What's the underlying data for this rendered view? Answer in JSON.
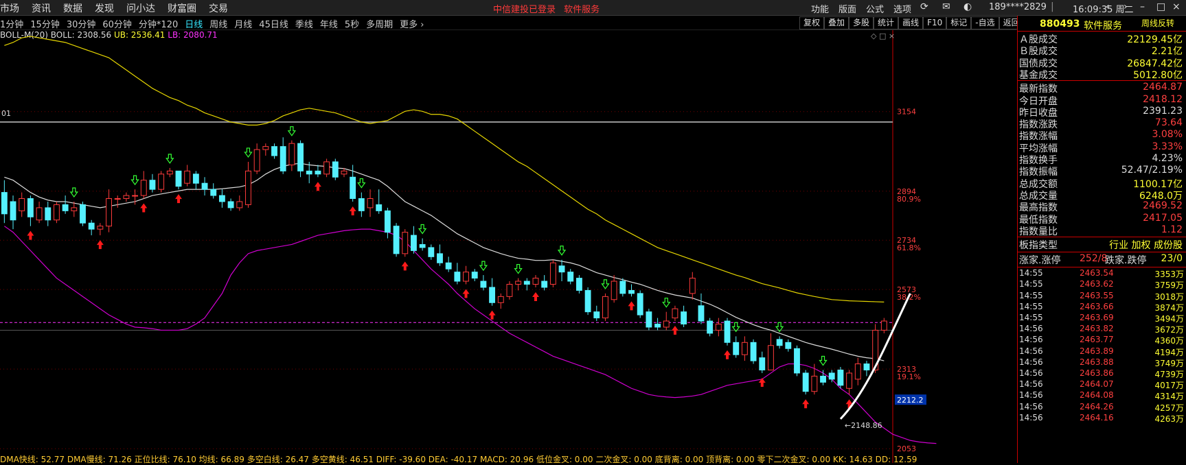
{
  "menubar": {
    "left_items": [
      "市场",
      "资讯",
      "数据",
      "发现",
      "问小达",
      "财富圈",
      "交易"
    ],
    "notice": [
      "中信建投已登录",
      "软件服务"
    ],
    "right_items": [
      "功能",
      "版面",
      "公式",
      "选项"
    ],
    "user": "189****2829",
    "time": "16:09:35 周二"
  },
  "periods": {
    "items": [
      "1分钟",
      "15分钟",
      "30分钟",
      "60分钟",
      "分钟*120",
      "日线",
      "周线",
      "月线",
      "45日线",
      "季线",
      "年线",
      "5秒",
      "多周期",
      "更多"
    ],
    "active_index": 5
  },
  "tools": [
    "复权",
    "叠加",
    "多股",
    "统计",
    "画线",
    "F10",
    "标记",
    "-自选",
    "返回"
  ],
  "boll": {
    "label": "BOLL-M(20)",
    "boll": "BOLL: 2308.56",
    "ub": "UB: 2536.41",
    "lb": "LB: 2080.71"
  },
  "price_axis": {
    "labels": [
      "3154",
      "2894",
      "2734",
      "2573",
      "2313",
      "2053"
    ],
    "fibs": [
      "80.9%",
      "61.8%",
      "38.2%",
      "19.1%"
    ],
    "current": "2212.2"
  },
  "annotations": {
    "low_marker": "2148.86",
    "left_label": "01"
  },
  "bottom_indicators": "DMA快线: 52.77  DMA慢线: 71.26  正位比线: 76.10  均线: 66.89  多空白线: 26.47  多空黄线: 46.51  DIFF: -39.60  DEA: -40.17  MACD: 20.96  低位金叉: 0.00  二次金叉: 0.00  底背离: 0.00  顶背离: 0.00  零下二次金叉: 0.00  KK: 14.63  DD: 12.59",
  "sidebar": {
    "code": "880493",
    "name": "软件服务",
    "tag": "周线反转",
    "summary": [
      {
        "k": "Ａ股成交",
        "v": "22129.45亿",
        "c": "#ffff33"
      },
      {
        "k": "Ｂ股成交",
        "v": "2.21亿",
        "c": "#ffff33"
      },
      {
        "k": "国债成交",
        "v": "26847.42亿",
        "c": "#ffff33"
      },
      {
        "k": "基金成交",
        "v": "5012.80亿",
        "c": "#ffff33"
      }
    ],
    "quote": [
      {
        "k": "最新指数",
        "v": "2464.87",
        "c": "#ff4040"
      },
      {
        "k": "今日开盘",
        "v": "2418.12",
        "c": "#ff4040"
      },
      {
        "k": "昨日收盘",
        "v": "2391.23",
        "c": "#dddddd"
      },
      {
        "k": "指数涨跌",
        "v": "73.64",
        "c": "#ff4040"
      },
      {
        "k": "指数涨幅",
        "v": "3.08%",
        "c": "#ff4040"
      },
      {
        "k": "平均涨幅",
        "v": "3.33%",
        "c": "#ff4040"
      },
      {
        "k": "指数换手",
        "v": "4.23%",
        "c": "#dddddd"
      },
      {
        "k": "指数振幅",
        "v": "52.47/2.19%",
        "c": "#dddddd"
      },
      {
        "k": "总成交额",
        "v": "1100.17亿",
        "c": "#ffff33"
      },
      {
        "k": "总成交量",
        "v": "6248.0万",
        "c": "#ffff33"
      },
      {
        "k": "最高指数",
        "v": "2469.52",
        "c": "#ff4040"
      },
      {
        "k": "最低指数",
        "v": "2417.05",
        "c": "#ff4040"
      },
      {
        "k": "指数量比",
        "v": "1.12",
        "c": "#ff4040"
      }
    ],
    "board": {
      "k": "板指类型",
      "v": "行业 加权 成份股",
      "c": "#ffff33"
    },
    "updown": {
      "k1": "涨家.涨停",
      "v1": "252/8",
      "k2": "跌家.跌停",
      "v2": "23/0"
    },
    "ticks": [
      {
        "t": "14:55",
        "p": "2463.54",
        "v": "3353万"
      },
      {
        "t": "14:55",
        "p": "2463.62",
        "v": "3759万"
      },
      {
        "t": "14:55",
        "p": "2463.55",
        "v": "3018万"
      },
      {
        "t": "14:55",
        "p": "2463.66",
        "v": "3874万"
      },
      {
        "t": "14:55",
        "p": "2463.69",
        "v": "3494万"
      },
      {
        "t": "14:56",
        "p": "2463.82",
        "v": "3672万"
      },
      {
        "t": "14:56",
        "p": "2463.77",
        "v": "4360万"
      },
      {
        "t": "14:56",
        "p": "2463.89",
        "v": "4194万"
      },
      {
        "t": "14:56",
        "p": "2463.88",
        "v": "3749万"
      },
      {
        "t": "14:56",
        "p": "2463.86",
        "v": "4739万"
      },
      {
        "t": "14:56",
        "p": "2464.07",
        "v": "4017万"
      },
      {
        "t": "14:56",
        "p": "2464.08",
        "v": "4314万"
      },
      {
        "t": "14:56",
        "p": "2464.26",
        "v": "4257万"
      },
      {
        "t": "14:56",
        "p": "2464.16",
        "v": "4263万"
      }
    ]
  },
  "chart_data": {
    "type": "candlestick",
    "ylim": [
      2040,
      3420
    ],
    "y_ticks": [
      3154,
      2894,
      2734,
      2573,
      2313,
      2053
    ],
    "candles": [
      [
        2890,
        2820,
        2930,
        2790
      ],
      [
        2860,
        2800,
        2880,
        2770
      ],
      [
        2830,
        2870,
        2890,
        2810
      ],
      [
        2870,
        2810,
        2880,
        2780
      ],
      [
        2800,
        2840,
        2860,
        2790
      ],
      [
        2840,
        2800,
        2860,
        2780
      ],
      [
        2800,
        2850,
        2860,
        2790
      ],
      [
        2850,
        2830,
        2880,
        2820
      ],
      [
        2830,
        2840,
        2860,
        2810
      ],
      [
        2850,
        2790,
        2860,
        2780
      ],
      [
        2790,
        2770,
        2800,
        2750
      ],
      [
        2770,
        2780,
        2790,
        2750
      ],
      [
        2780,
        2870,
        2900,
        2760
      ],
      [
        2870,
        2870,
        2880,
        2840
      ],
      [
        2870,
        2880,
        2890,
        2860
      ],
      [
        2880,
        2880,
        2900,
        2850
      ],
      [
        2880,
        2930,
        2960,
        2870
      ],
      [
        2930,
        2900,
        2950,
        2890
      ],
      [
        2900,
        2950,
        2960,
        2890
      ],
      [
        2950,
        2960,
        2970,
        2940
      ],
      [
        2960,
        2910,
        2960,
        2900
      ],
      [
        2920,
        2960,
        2980,
        2910
      ],
      [
        2950,
        2920,
        2960,
        2900
      ],
      [
        2920,
        2900,
        2940,
        2880
      ],
      [
        2900,
        2880,
        2920,
        2870
      ],
      [
        2880,
        2860,
        2900,
        2840
      ],
      [
        2860,
        2840,
        2870,
        2830
      ],
      [
        2840,
        2860,
        2880,
        2830
      ],
      [
        2850,
        2960,
        2990,
        2840
      ],
      [
        2960,
        3030,
        3050,
        2950
      ],
      [
        3030,
        3040,
        3050,
        3010
      ],
      [
        3040,
        3010,
        3050,
        3000
      ],
      [
        3040,
        2960,
        3070,
        2950
      ],
      [
        2980,
        3050,
        3060,
        2960
      ],
      [
        3050,
        2960,
        3060,
        2940
      ],
      [
        2960,
        2950,
        2990,
        2920
      ],
      [
        2960,
        2950,
        2980,
        2940
      ],
      [
        2950,
        2990,
        3000,
        2940
      ],
      [
        2990,
        2940,
        3000,
        2930
      ],
      [
        2950,
        2960,
        2970,
        2940
      ],
      [
        2940,
        2870,
        2980,
        2860
      ],
      [
        2870,
        2830,
        2890,
        2810
      ],
      [
        2840,
        2870,
        2900,
        2810
      ],
      [
        2850,
        2830,
        2900,
        2820
      ],
      [
        2830,
        2760,
        2840,
        2740
      ],
      [
        2780,
        2690,
        2790,
        2680
      ],
      [
        2690,
        2760,
        2770,
        2680
      ],
      [
        2750,
        2700,
        2780,
        2690
      ],
      [
        2720,
        2710,
        2740,
        2700
      ],
      [
        2710,
        2680,
        2720,
        2670
      ],
      [
        2690,
        2660,
        2720,
        2650
      ],
      [
        2660,
        2640,
        2680,
        2630
      ],
      [
        2630,
        2600,
        2660,
        2590
      ],
      [
        2600,
        2630,
        2650,
        2590
      ],
      [
        2630,
        2610,
        2640,
        2600
      ],
      [
        2600,
        2580,
        2620,
        2570
      ],
      [
        2580,
        2530,
        2610,
        2520
      ],
      [
        2530,
        2550,
        2560,
        2510
      ],
      [
        2550,
        2590,
        2600,
        2540
      ],
      [
        2590,
        2600,
        2610,
        2570
      ],
      [
        2600,
        2590,
        2610,
        2570
      ],
      [
        2590,
        2610,
        2620,
        2580
      ],
      [
        2600,
        2580,
        2620,
        2570
      ],
      [
        2590,
        2660,
        2670,
        2580
      ],
      [
        2650,
        2630,
        2670,
        2600
      ],
      [
        2630,
        2600,
        2640,
        2590
      ],
      [
        2610,
        2570,
        2620,
        2560
      ],
      [
        2570,
        2500,
        2580,
        2490
      ],
      [
        2500,
        2480,
        2520,
        2470
      ],
      [
        2480,
        2550,
        2560,
        2470
      ],
      [
        2540,
        2600,
        2620,
        2530
      ],
      [
        2600,
        2560,
        2610,
        2550
      ],
      [
        2570,
        2560,
        2590,
        2550
      ],
      [
        2560,
        2490,
        2570,
        2480
      ],
      [
        2500,
        2450,
        2510,
        2440
      ],
      [
        2460,
        2450,
        2480,
        2440
      ],
      [
        2450,
        2470,
        2500,
        2440
      ],
      [
        2480,
        2510,
        2520,
        2470
      ],
      [
        2500,
        2460,
        2520,
        2450
      ],
      [
        2560,
        2610,
        2630,
        2540
      ],
      [
        2520,
        2470,
        2560,
        2460
      ],
      [
        2470,
        2430,
        2480,
        2420
      ],
      [
        2440,
        2460,
        2480,
        2420
      ],
      [
        2470,
        2400,
        2480,
        2390
      ],
      [
        2400,
        2360,
        2420,
        2350
      ],
      [
        2360,
        2400,
        2420,
        2340
      ],
      [
        2400,
        2340,
        2410,
        2330
      ],
      [
        2350,
        2310,
        2370,
        2300
      ],
      [
        2310,
        2390,
        2430,
        2310
      ],
      [
        2410,
        2390,
        2420,
        2380
      ],
      [
        2400,
        2380,
        2410,
        2370
      ],
      [
        2380,
        2300,
        2390,
        2290
      ],
      [
        2300,
        2240,
        2310,
        2230
      ],
      [
        2240,
        2290,
        2330,
        2230
      ],
      [
        2290,
        2270,
        2310,
        2260
      ],
      [
        2300,
        2280,
        2310,
        2270
      ],
      [
        2310,
        2260,
        2320,
        2250
      ],
      [
        2250,
        2300,
        2310,
        2230
      ],
      [
        2280,
        2330,
        2350,
        2260
      ],
      [
        2330,
        2310,
        2340,
        2290
      ],
      [
        2310,
        2440,
        2460,
        2300
      ],
      [
        2440,
        2470,
        2480,
        2430
      ]
    ],
    "mid_line": [
      2940,
      2930,
      2910,
      2890,
      2875,
      2865,
      2860,
      2860,
      2855,
      2850,
      2845,
      2840,
      2845,
      2850,
      2855,
      2860,
      2870,
      2880,
      2885,
      2890,
      2895,
      2900,
      2900,
      2900,
      2900,
      2902,
      2905,
      2908,
      2915,
      2930,
      2950,
      2965,
      2975,
      2982,
      2985,
      2980,
      2977,
      2975,
      2970,
      2968,
      2960,
      2950,
      2940,
      2930,
      2910,
      2885,
      2860,
      2845,
      2830,
      2815,
      2795,
      2775,
      2755,
      2740,
      2725,
      2710,
      2700,
      2690,
      2682,
      2675,
      2672,
      2668,
      2668,
      2670,
      2665,
      2660,
      2652,
      2640,
      2628,
      2620,
      2612,
      2605,
      2597,
      2590,
      2580,
      2570,
      2562,
      2555,
      2550,
      2545,
      2535,
      2525,
      2512,
      2497,
      2482,
      2470,
      2458,
      2448,
      2440,
      2430,
      2420,
      2410,
      2400,
      2392,
      2385,
      2378,
      2370,
      2362,
      2355,
      2350,
      2347,
      2340
    ],
    "upper_line": [
      3370,
      3380,
      3395,
      3400,
      3395,
      3390,
      3385,
      3380,
      3370,
      3360,
      3350,
      3340,
      3330,
      3310,
      3290,
      3270,
      3250,
      3230,
      3215,
      3200,
      3190,
      3175,
      3165,
      3150,
      3140,
      3130,
      3120,
      3115,
      3110,
      3110,
      3115,
      3125,
      3140,
      3150,
      3160,
      3165,
      3160,
      3155,
      3150,
      3140,
      3130,
      3120,
      3115,
      3120,
      3125,
      3140,
      3155,
      3160,
      3155,
      3145,
      3145,
      3140,
      3130,
      3110,
      3090,
      3070,
      3050,
      3030,
      3010,
      2990,
      2975,
      2955,
      2935,
      2915,
      2895,
      2875,
      2855,
      2835,
      2820,
      2800,
      2785,
      2770,
      2755,
      2740,
      2725,
      2710,
      2700,
      2690,
      2680,
      2670,
      2660,
      2650,
      2640,
      2630,
      2620,
      2612,
      2602,
      2592,
      2585,
      2578,
      2570,
      2562,
      2556,
      2550,
      2545,
      2540,
      2538,
      2536,
      2535,
      2534,
      2533,
      2532
    ],
    "lower_line": [
      2780,
      2760,
      2730,
      2700,
      2670,
      2640,
      2610,
      2590,
      2570,
      2550,
      2530,
      2510,
      2490,
      2475,
      2460,
      2450,
      2448,
      2445,
      2440,
      2440,
      2440,
      2445,
      2460,
      2480,
      2520,
      2560,
      2620,
      2660,
      2690,
      2700,
      2705,
      2710,
      2715,
      2720,
      2730,
      2740,
      2750,
      2755,
      2760,
      2765,
      2768,
      2770,
      2770,
      2765,
      2760,
      2750,
      2730,
      2700,
      2670,
      2640,
      2615,
      2590,
      2560,
      2535,
      2510,
      2490,
      2470,
      2450,
      2430,
      2415,
      2400,
      2385,
      2370,
      2355,
      2345,
      2335,
      2325,
      2315,
      2305,
      2295,
      2280,
      2265,
      2250,
      2240,
      2230,
      2225,
      2222,
      2220,
      2222,
      2225,
      2230,
      2240,
      2250,
      2260,
      2265,
      2270,
      2275,
      2280,
      2300,
      2320,
      2330,
      2330,
      2325,
      2315,
      2300,
      2280,
      2250,
      2230,
      2200,
      2170,
      2140,
      2120,
      2100,
      2090,
      2080,
      2075,
      2072,
      2070
    ],
    "current_dashed": 2465,
    "ref_lines": [
      3120,
      2440
    ],
    "buy_arrows": [
      3,
      11,
      16,
      20,
      36,
      40,
      46,
      53,
      56,
      61,
      72,
      77,
      83,
      87,
      92,
      97
    ],
    "sell_arrows": [
      8,
      15,
      19,
      28,
      33,
      41,
      48,
      55,
      59,
      64,
      69,
      76,
      84,
      89,
      94
    ]
  }
}
